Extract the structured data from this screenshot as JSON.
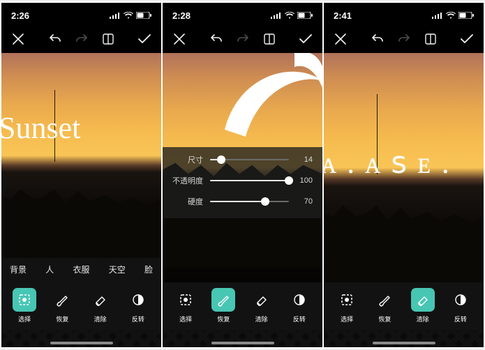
{
  "accent": "#47c6b3",
  "screens": [
    {
      "time": "2:26",
      "canvas_text": "Sunset",
      "tabs": [
        "背景",
        "人",
        "衣服",
        "天空",
        "脸"
      ],
      "tools": [
        {
          "key": "select",
          "label": "选择",
          "icon": "select-icon",
          "active": true
        },
        {
          "key": "restore",
          "label": "恢复",
          "icon": "brush-icon",
          "active": false
        },
        {
          "key": "erase",
          "label": "清除",
          "icon": "eraser-icon",
          "active": false
        },
        {
          "key": "invert",
          "label": "反转",
          "icon": "invert-icon",
          "active": false
        }
      ]
    },
    {
      "time": "2:28",
      "sliders": [
        {
          "label": "尺寸",
          "value": 14,
          "max": 100,
          "pct": 14
        },
        {
          "label": "不透明度",
          "value": 100,
          "max": 100,
          "pct": 100
        },
        {
          "label": "硬度",
          "value": 70,
          "max": 100,
          "pct": 70
        }
      ],
      "tools": [
        {
          "key": "select",
          "label": "选择",
          "icon": "select-icon",
          "active": false
        },
        {
          "key": "restore",
          "label": "恢复",
          "icon": "brush-icon",
          "active": true
        },
        {
          "key": "erase",
          "label": "清除",
          "icon": "eraser-icon",
          "active": false
        },
        {
          "key": "invert",
          "label": "反转",
          "icon": "invert-icon",
          "active": false
        }
      ]
    },
    {
      "time": "2:41",
      "canvas_text": "ᴀ . ᴀ ꜱ ᴇ .",
      "tools": [
        {
          "key": "select",
          "label": "选择",
          "icon": "select-icon",
          "active": false
        },
        {
          "key": "restore",
          "label": "恢复",
          "icon": "brush-icon",
          "active": false
        },
        {
          "key": "erase",
          "label": "清除",
          "icon": "eraser-icon",
          "active": true
        },
        {
          "key": "invert",
          "label": "反转",
          "icon": "invert-icon",
          "active": false
        }
      ]
    }
  ]
}
